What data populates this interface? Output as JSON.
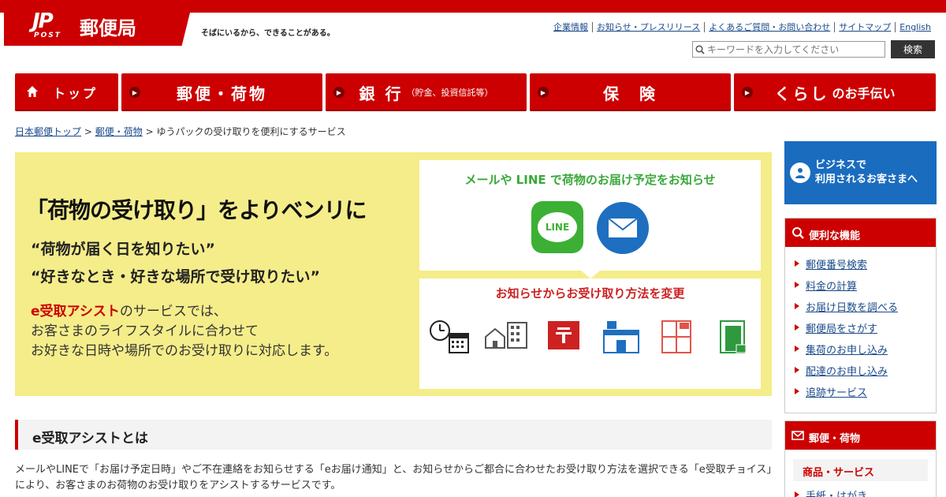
{
  "header": {
    "logo_mark": "JP",
    "logo_post": "POST",
    "logo_text": "郵便局",
    "tagline": "そばにいるから、できることがある。",
    "utility_links": [
      "企業情報",
      "お知らせ・プレスリリース",
      "よくあるご質問・お問い合わせ",
      "サイトマップ",
      "English"
    ],
    "search_placeholder": "キーワードを入力してください",
    "search_button": "検索"
  },
  "gnav": {
    "home": "トップ",
    "items": [
      {
        "label": "郵便・荷物",
        "sub": ""
      },
      {
        "label": "銀 行",
        "sub": "（貯金、投資信託等）"
      },
      {
        "label": "保　険",
        "sub": ""
      },
      {
        "label": "くらし",
        "sub": "のお手伝い"
      }
    ]
  },
  "breadcrumb": {
    "links": [
      "日本郵便トップ",
      "郵便・荷物"
    ],
    "current": "ゆうパックの受け取りを便利にするサービス",
    "sep": ">"
  },
  "hero": {
    "title": "「荷物の受け取り」をよりベンリに",
    "q1": "“荷物が届く日を知りたい”",
    "q2": "“好きなとき・好きな場所で受け取りたい”",
    "desc_em": "e受取アシスト",
    "desc_1": "のサービスでは、",
    "desc_2": "お客さまのライフスタイルに合わせて",
    "desc_3": "お好きな日時や場所でのお受け取りに対応します。",
    "panel1_title": "メールや LINE で荷物のお届け予定をお知らせ",
    "line_label": "LINE",
    "panel2_title": "お知らせからお受け取り方法を変更"
  },
  "section": {
    "title": "e受取アシストとは",
    "body": "メールやLINEで「お届け予定日時」やご不在連絡をお知らせする「eお届け通知」と、お知らせからご都合に合わせたお受け取り方法を選択できる「e受取チョイス」により、お客さまのお荷物のお受け取りをアシストするサービスです。"
  },
  "sidebar": {
    "business": [
      "ビジネスで",
      "利用されるお客さまへ"
    ],
    "features_title": "便利な機能",
    "features": [
      "郵便番号検索",
      "料金の計算",
      "お届け日数を調べる",
      "郵便局をさがす",
      "集荷のお申し込み",
      "配達のお申し込み",
      "追跡サービス"
    ],
    "mail_title": "郵便・荷物",
    "mail_sub": "商品・サービス",
    "mail_items": [
      "手紙・はがき"
    ]
  },
  "colors": {
    "brand_red": "#cc0000",
    "hero_yellow": "#f5ed8a",
    "business_blue": "#1a6cbf",
    "line_green": "#3cb034"
  }
}
